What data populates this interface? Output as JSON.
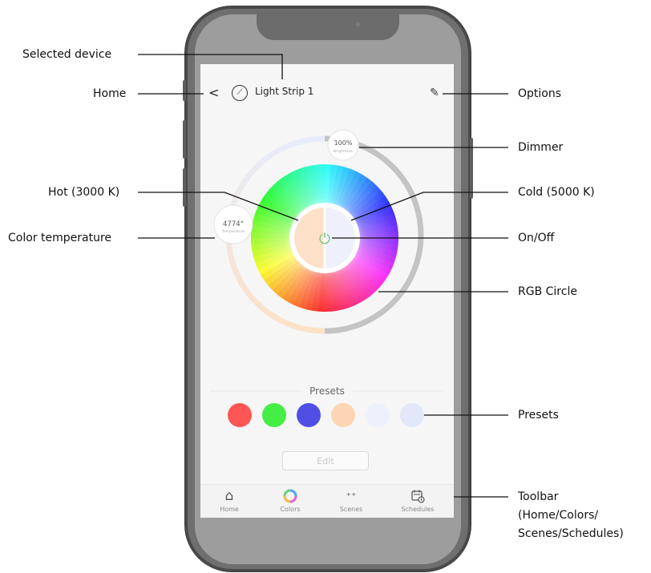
{
  "app": {
    "device_name": "Light Strip 1",
    "back_glyph": "<",
    "edit_glyph": "✎",
    "device_icon": "light-strip-icon"
  },
  "wheel": {
    "brightness_value": "100%",
    "brightness_label": "Brightness",
    "temperature_value": "4774°",
    "temperature_label": "Temperature",
    "power_glyph": "⏻"
  },
  "presets": {
    "title": "Presets",
    "swatches": [
      "#ff5555",
      "#44ee44",
      "#4f4fe8",
      "#fcd6b4",
      "#eef0fb",
      "#e2e8f8"
    ],
    "edit_label": "Edit"
  },
  "toolbar": {
    "items": [
      {
        "label": "Home",
        "icon": "home-icon"
      },
      {
        "label": "Colors",
        "icon": "color-ring-icon"
      },
      {
        "label": "Scenes",
        "icon": "sparkles-icon"
      },
      {
        "label": "Schedules",
        "icon": "calendar-clock-icon"
      }
    ]
  },
  "callouts": {
    "selected_device": "Selected device",
    "home": "Home",
    "options": "Options",
    "dimmer": "Dimmer",
    "hot": "Hot (3000 K)",
    "cold": "Cold (5000 K)",
    "color_temperature": "Color temperature",
    "on_off": "On/Off",
    "rgb_circle": "RGB Circle",
    "presets": "Presets",
    "toolbar_line1": "Toolbar",
    "toolbar_line2": "(Home/Colors/",
    "toolbar_line3": "Scenes/Schedules)"
  }
}
